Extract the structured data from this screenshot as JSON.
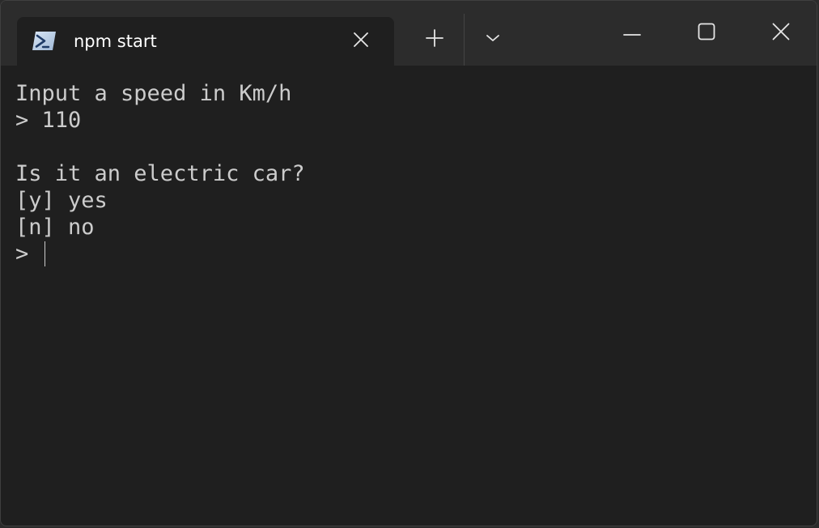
{
  "window": {
    "tab_title": "npm start",
    "tab_icon": "powershell-icon"
  },
  "controls": {
    "new_tab_icon": "plus-icon",
    "dropdown_icon": "chevron-down-icon",
    "minimize_icon": "minimize-icon",
    "maximize_icon": "maximize-icon",
    "close_icon": "close-icon"
  },
  "terminal": {
    "lines": [
      "Input a speed in Km/h",
      "> 110",
      "",
      "Is it an electric car?",
      "[y] yes",
      "[n] no"
    ],
    "prompt": "> "
  },
  "colors": {
    "background": "#1f1f1f",
    "titlebar": "#2c2c2c",
    "text": "#cccccc"
  }
}
